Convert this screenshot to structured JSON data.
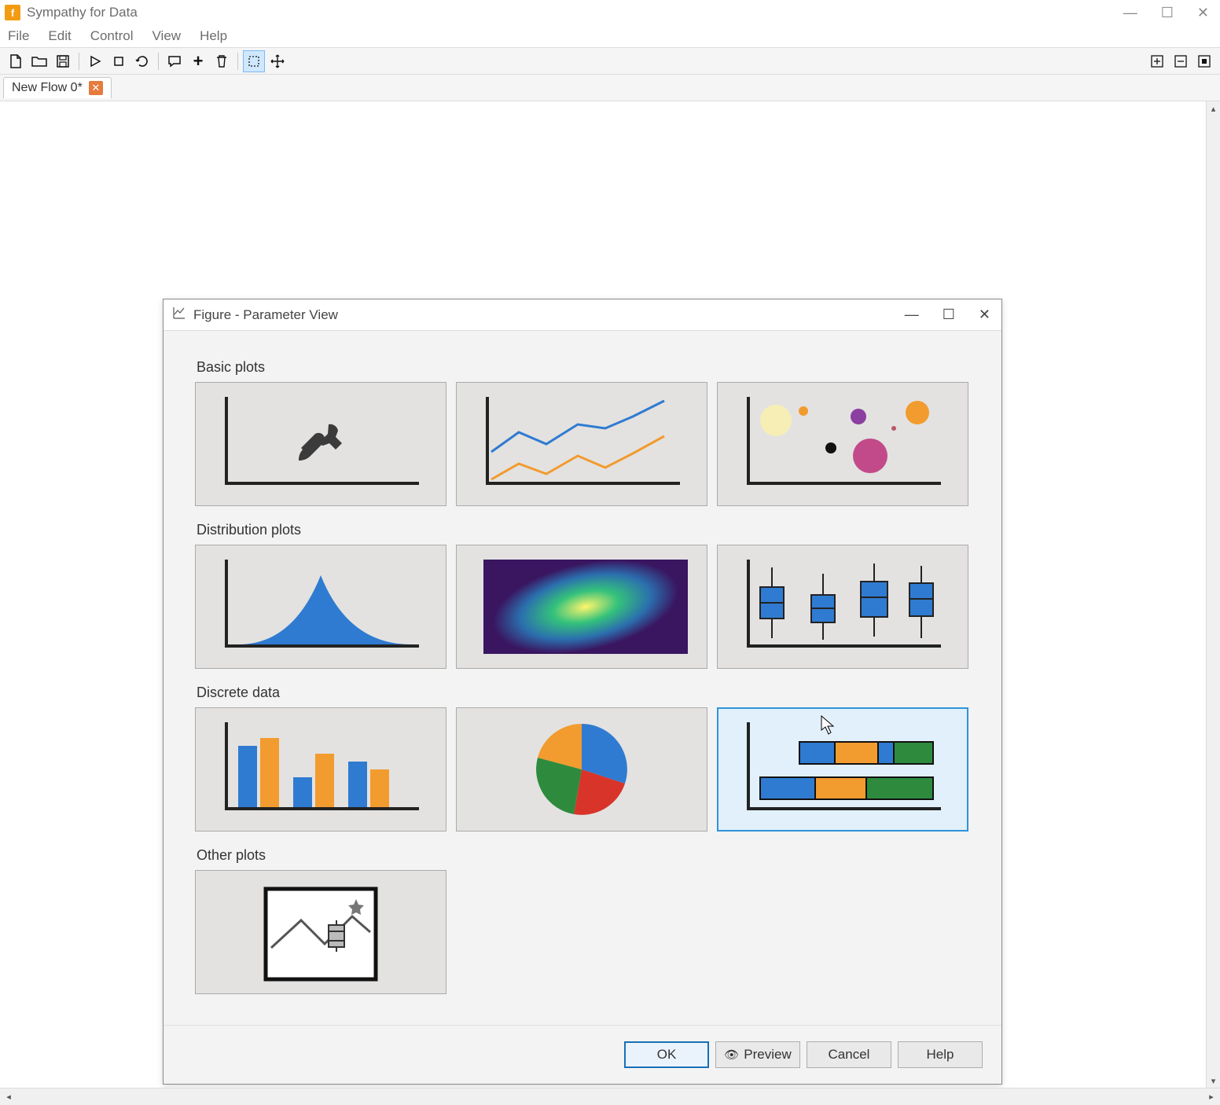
{
  "app": {
    "title": "Sympathy for Data"
  },
  "menu": {
    "file": "File",
    "edit": "Edit",
    "control": "Control",
    "view": "View",
    "help": "Help"
  },
  "tab": {
    "label": "New Flow 0*"
  },
  "dialog": {
    "title": "Figure - Parameter View",
    "sections": {
      "basic": "Basic plots",
      "distribution": "Distribution plots",
      "discrete": "Discrete data",
      "other": "Other plots"
    },
    "selected_card": "timeline-plot",
    "buttons": {
      "ok": "OK",
      "preview": "Preview",
      "cancel": "Cancel",
      "help": "Help"
    }
  },
  "toolbar": {
    "icons": [
      "new-file",
      "open-file",
      "save-file",
      "run",
      "stop",
      "reload",
      "chat",
      "add",
      "delete",
      "select-area",
      "pan"
    ],
    "right_icons": [
      "zoom-in",
      "zoom-out",
      "fit"
    ],
    "active": "select-area"
  }
}
